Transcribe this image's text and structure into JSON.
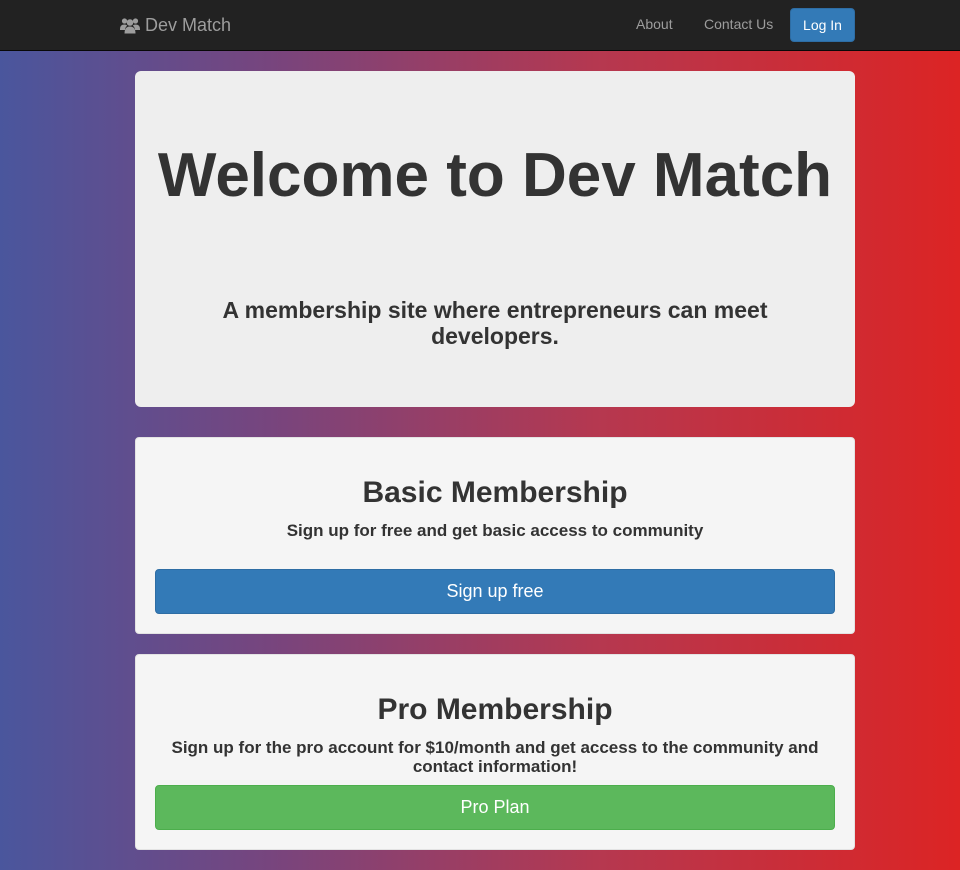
{
  "navbar": {
    "brand_label": "Dev Match",
    "brand_icon": "users-icon",
    "links": [
      "About",
      "Contact Us"
    ],
    "login_label": "Log In"
  },
  "jumbotron": {
    "title": "Welcome to Dev Match",
    "subtitle": "A membership site where entrepreneurs can meet developers."
  },
  "basic": {
    "title": "Basic Membership",
    "description": "Sign up for free and get basic access to community",
    "button_label": "Sign up free"
  },
  "pro": {
    "title": "Pro Membership",
    "description": "Sign up for the pro account for $10/month and get access to the community and contact information!",
    "button_label": "Pro Plan"
  },
  "colors": {
    "navbar": "#222222",
    "primary": "#337ab7",
    "success": "#5cb85c",
    "gradient_left": "#4a569d",
    "gradient_right": "#dc2424"
  }
}
